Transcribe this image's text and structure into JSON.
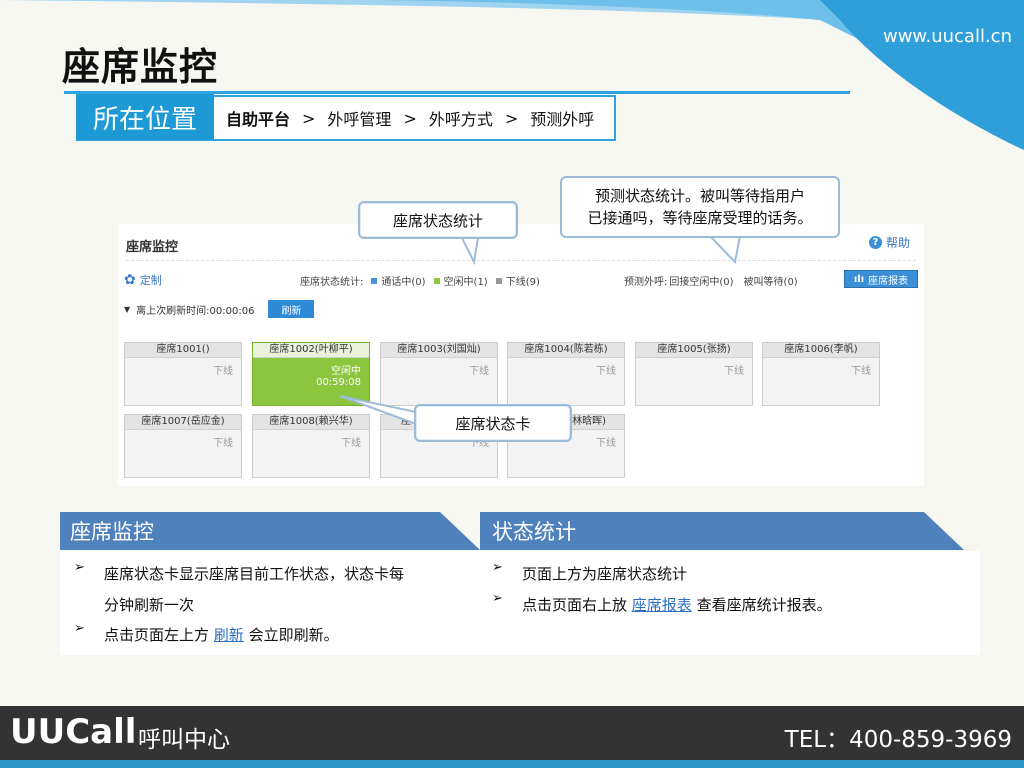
{
  "site_url": "www.uucall.cn",
  "slide_title": "座席监控",
  "location": {
    "label": "所在位置",
    "crumbs": [
      "自助平台",
      "外呼管理",
      "外呼方式",
      "预测外呼"
    ],
    "separator": ">"
  },
  "panel": {
    "title": "座席监控",
    "help": "帮助",
    "custom": "定制",
    "status_label": "座席状态统计:",
    "status_items": [
      {
        "label": "通话中(0)",
        "color": "#4a90d9"
      },
      {
        "label": "空闲中(1)",
        "color": "#8cc63f"
      },
      {
        "label": "下线(9)",
        "color": "#999999"
      }
    ],
    "predict_label": "预测外呼:",
    "predict_items": [
      "回接空闲中(0)",
      "被叫等待(0)"
    ],
    "report_button": "座席报表",
    "refresh_time_label": "离上次刷新时间:00:00:06",
    "refresh_button": "刷新",
    "cards": [
      {
        "name": "座席1001()",
        "status": "下线",
        "time": ""
      },
      {
        "name": "座席1002(叶柳平)",
        "status": "空闲中",
        "time": "00:59:08"
      },
      {
        "name": "座席1003(刘国灿)",
        "status": "下线",
        "time": ""
      },
      {
        "name": "座席1004(陈若栋)",
        "status": "下线",
        "time": ""
      },
      {
        "name": "座席1005(张扬)",
        "status": "下线",
        "time": ""
      },
      {
        "name": "座席1006(李帆)",
        "status": "下线",
        "time": ""
      },
      {
        "name": "座席1007(岳应金)",
        "status": "下线",
        "time": ""
      },
      {
        "name": "座席1008(赖兴华)",
        "status": "下线",
        "time": ""
      },
      {
        "name": "座",
        "status": "下线",
        "time": ""
      },
      {
        "name": "林晗晖)",
        "status": "下线",
        "time": ""
      }
    ]
  },
  "callouts": {
    "stats": "座席状态统计",
    "predict_line1": "预测状态统计。被叫等待指用户",
    "predict_line2": "已接通吗，等待座席受理的话务。",
    "card": "座席状态卡"
  },
  "sections": {
    "left": {
      "title": "座席监控",
      "b1_line1": "座席状态卡显示座席目前工作状态，状态卡每",
      "b1_line2": "分钟刷新一次",
      "b2_pre": "点击页面左上方",
      "b2_link": "刷新",
      "b2_post": "会立即刷新。"
    },
    "right": {
      "title": "状态统计",
      "b1": "页面上方为座席状态统计",
      "b2_pre": "点击页面右上放",
      "b2_link": "座席报表",
      "b2_post": "查看座席统计报表。"
    },
    "bullet_glyph": "➢"
  },
  "footer": {
    "brand": "UUCall",
    "brand_sub": "呼叫中心",
    "tel": "TEL：400-859-3969"
  },
  "colors": {
    "accent": "#2ea3dd",
    "section_header": "#4f81bd",
    "idle_green": "#8cc63f",
    "footer_bg": "#333333"
  }
}
